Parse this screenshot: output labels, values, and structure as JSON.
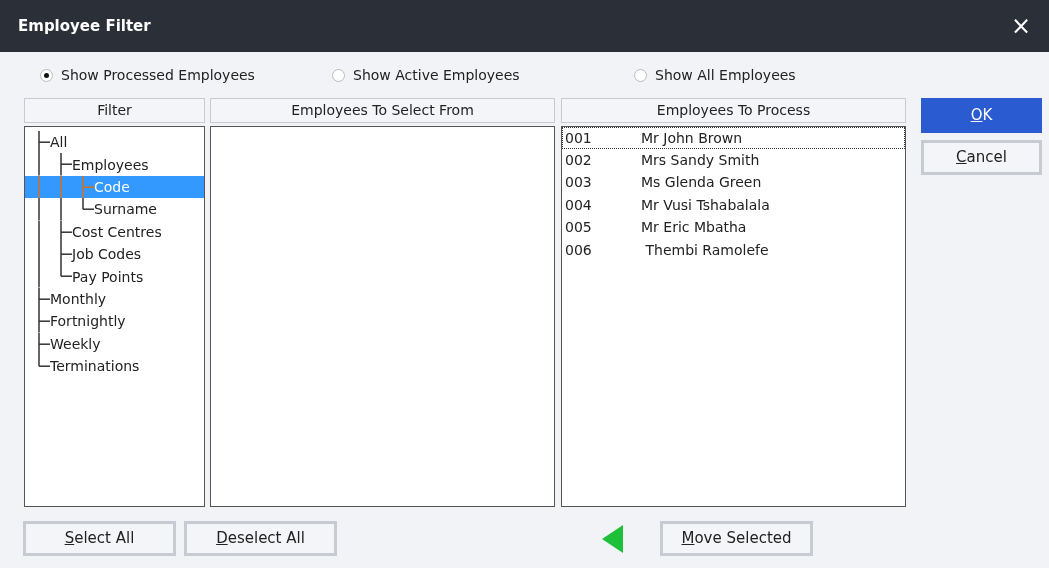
{
  "window": {
    "title": "Employee Filter",
    "close": "×"
  },
  "view_options": [
    {
      "label": "Show Processed Employees",
      "selected": true
    },
    {
      "label": "Show Active Employees",
      "selected": false
    },
    {
      "label": "Show All Employees",
      "selected": false
    }
  ],
  "filter": {
    "header": "Filter",
    "tree": [
      {
        "label": "All",
        "selected": false,
        "children": [
          {
            "label": "Employees",
            "selected": false,
            "children": [
              {
                "label": "Code",
                "selected": true
              },
              {
                "label": "Surname",
                "selected": false
              }
            ]
          },
          {
            "label": "Cost Centres",
            "selected": false
          },
          {
            "label": "Job Codes",
            "selected": false
          },
          {
            "label": "Pay Points",
            "selected": false
          }
        ]
      },
      {
        "label": "Monthly",
        "selected": false
      },
      {
        "label": "Fortnightly",
        "selected": false
      },
      {
        "label": "Weekly",
        "selected": false
      },
      {
        "label": "Terminations",
        "selected": false
      }
    ]
  },
  "select_from": {
    "header": "Employees To Select From"
  },
  "to_process": {
    "header": "Employees To Process",
    "rows": [
      {
        "code": "001",
        "name": "Mr John Brown",
        "focused": true
      },
      {
        "code": "002",
        "name": "Mrs Sandy Smith",
        "focused": false
      },
      {
        "code": "003",
        "name": "Ms Glenda Green",
        "focused": false
      },
      {
        "code": "004",
        "name": "Mr Vusi Tshabalala",
        "focused": false
      },
      {
        "code": "005",
        "name": "Mr Eric Mbatha",
        "focused": false
      },
      {
        "code": "006",
        "name": " Thembi Ramolefe",
        "focused": false
      }
    ]
  },
  "side_buttons": [
    {
      "label": "OK",
      "access_key_underlined": true,
      "kind": "primary"
    },
    {
      "label": "Cancel",
      "access_key_underlined": true,
      "kind": "normal"
    }
  ],
  "bottom_buttons": [
    {
      "label": "Select All",
      "access_key_underlined": true
    },
    {
      "label": "Deselect All",
      "access_key_underlined": true
    }
  ],
  "move_button": {
    "label": "Move Selected",
    "access_key_underlined": true
  }
}
